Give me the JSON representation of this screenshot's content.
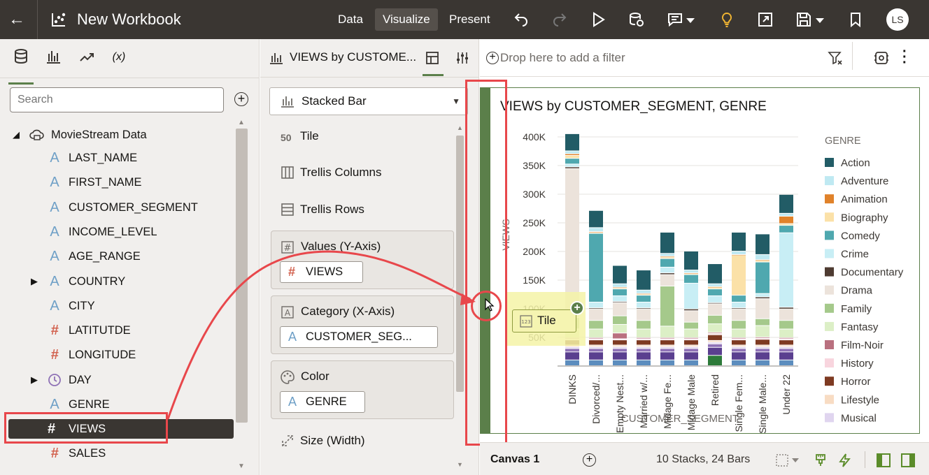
{
  "app": {
    "title": "New Workbook",
    "user_initials": "LS"
  },
  "modes": [
    {
      "label": "Data",
      "active": false
    },
    {
      "label": "Visualize",
      "active": true
    },
    {
      "label": "Present",
      "active": false
    }
  ],
  "search": {
    "placeholder": "Search"
  },
  "data_tree": {
    "root": "MovieStream Data",
    "items": [
      {
        "label": "LAST_NAME",
        "type": "attribute",
        "expandable": false
      },
      {
        "label": "FIRST_NAME",
        "type": "attribute",
        "expandable": false
      },
      {
        "label": "CUSTOMER_SEGMENT",
        "type": "attribute",
        "expandable": false
      },
      {
        "label": "INCOME_LEVEL",
        "type": "attribute",
        "expandable": false
      },
      {
        "label": "AGE_RANGE",
        "type": "attribute",
        "expandable": false
      },
      {
        "label": "COUNTRY",
        "type": "attribute",
        "expandable": true
      },
      {
        "label": "CITY",
        "type": "attribute",
        "expandable": false
      },
      {
        "label": "LATITUTDE",
        "type": "measure",
        "expandable": false
      },
      {
        "label": "LONGITUDE",
        "type": "measure",
        "expandable": false
      },
      {
        "label": "DAY",
        "type": "time",
        "expandable": true
      },
      {
        "label": "GENRE",
        "type": "attribute",
        "expandable": false
      },
      {
        "label": "VIEWS",
        "type": "measure",
        "expandable": false,
        "selected": true
      },
      {
        "label": "SALES",
        "type": "measure",
        "expandable": false
      }
    ]
  },
  "grammar": {
    "header": "VIEWS by CUSTOME...",
    "chart_type": "Stacked Bar",
    "tile": "Tile",
    "trellis_columns": "Trellis Columns",
    "trellis_rows": "Trellis Rows",
    "values_label": "Values (Y-Axis)",
    "values_field": "VIEWS",
    "category_label": "Category (X-Axis)",
    "category_field": "CUSTOMER_SEG...",
    "color_label": "Color",
    "color_field": "GENRE",
    "size_label": "Size (Width)"
  },
  "filterbar": {
    "placeholder": "Drop here to add a filter"
  },
  "drag_tooltip": "Tile",
  "footer": {
    "canvas_tab": "Canvas 1",
    "status": "10 Stacks, 24 Bars"
  },
  "chart_data": {
    "type": "bar",
    "title": "VIEWS by CUSTOMER_SEGMENT, GENRE",
    "xlabel": "CUSTOMER_SEGMENT",
    "ylabel": "VIEWS",
    "ylim": [
      0,
      400000
    ],
    "yticks": [
      "50K",
      "100K",
      "150K",
      "200K",
      "250K",
      "300K",
      "350K",
      "400K"
    ],
    "categories": [
      "DINKS",
      "Divorced/...",
      "Empty Nest...",
      "Married w/...",
      "Midage Fe...",
      "Midage Male",
      "Retired",
      "Single Fem...",
      "Single Male...",
      "Under 22"
    ],
    "legend_title": "GENRE",
    "series": [
      {
        "name": "Action",
        "color": "#225c66",
        "values": [
          30000,
          30000,
          32000,
          35000,
          37000,
          33000,
          35000,
          33000,
          36000,
          33000
        ]
      },
      {
        "name": "Adventure",
        "color": "#bfe9f2",
        "values": [
          5000,
          7000,
          6000,
          6000,
          5000,
          5000,
          5000,
          6000,
          9000,
          5000
        ]
      },
      {
        "name": "Animation",
        "color": "#e0822a",
        "values": [
          3000,
          1000,
          1000,
          1000,
          1000,
          1000,
          1000,
          1000,
          1000,
          13000
        ]
      },
      {
        "name": "Biography",
        "color": "#fbe1a8",
        "values": [
          5000,
          2000,
          2000,
          2000,
          3000,
          2000,
          3000,
          70000,
          3000,
          3000
        ]
      },
      {
        "name": "Comedy",
        "color": "#4fa8af",
        "values": [
          10000,
          120000,
          12000,
          12000,
          15000,
          15000,
          12000,
          12000,
          55000,
          13000
        ]
      },
      {
        "name": "Crime",
        "color": "#c8eef5",
        "values": [
          5000,
          10000,
          10000,
          10000,
          10000,
          45000,
          12000,
          10000,
          6000,
          130000
        ]
      },
      {
        "name": "Documentary",
        "color": "#4e3b31",
        "values": [
          3000,
          2000,
          2000,
          2000,
          3000,
          3000,
          2000,
          2000,
          3000,
          3000
        ]
      },
      {
        "name": "Drama",
        "color": "#ece3db",
        "values": [
          260000,
          20000,
          23000,
          20000,
          20000,
          20000,
          20000,
          20000,
          35000,
          20000
        ]
      },
      {
        "name": "Family",
        "color": "#a5c98b",
        "values": [
          20000,
          15000,
          15000,
          15000,
          70000,
          12000,
          15000,
          15000,
          12000,
          15000
        ]
      },
      {
        "name": "Fantasy",
        "color": "#dcefc6",
        "values": [
          15000,
          15000,
          15000,
          15000,
          20000,
          15000,
          15000,
          15000,
          20000,
          15000
        ]
      },
      {
        "name": "Film-Noir",
        "color": "#b9707f",
        "values": [
          2000,
          2000,
          10000,
          2000,
          2000,
          2000,
          2000,
          2000,
          2000,
          2000
        ]
      },
      {
        "name": "History",
        "color": "#f8d5de",
        "values": [
          2000,
          2000,
          2000,
          2000,
          2000,
          2000,
          2000,
          2000,
          2000,
          2000
        ]
      },
      {
        "name": "Horror",
        "color": "#7e3a22",
        "values": [
          9000,
          9000,
          9000,
          9000,
          9000,
          9000,
          10000,
          9000,
          10000,
          9000
        ]
      },
      {
        "name": "Lifestyle",
        "color": "#f8dcc3",
        "values": [
          3000,
          3000,
          3000,
          3000,
          3000,
          3000,
          3000,
          3000,
          3000,
          3000
        ]
      },
      {
        "name": "Musical",
        "color": "#e0d5ef",
        "values": [
          3000,
          3000,
          3000,
          3000,
          3000,
          3000,
          3000,
          3000,
          3000,
          3000
        ]
      },
      {
        "name": "",
        "color": "#8f72b6",
        "values": [
          6000,
          6000,
          6000,
          6000,
          6000,
          6000,
          6000,
          6000,
          6000,
          6000
        ]
      },
      {
        "name": "",
        "color": "#5a3f8f",
        "values": [
          14000,
          14000,
          14000,
          14000,
          14000,
          14000,
          14000,
          14000,
          14000,
          14000
        ]
      },
      {
        "name": "",
        "color": "#2d7a3a",
        "values": [
          0,
          0,
          0,
          0,
          0,
          0,
          18000,
          0,
          0,
          0
        ]
      },
      {
        "name": "",
        "color": "#5c8dbe",
        "values": [
          10000,
          10000,
          10000,
          10000,
          10000,
          10000,
          0,
          10000,
          10000,
          10000
        ]
      }
    ]
  }
}
